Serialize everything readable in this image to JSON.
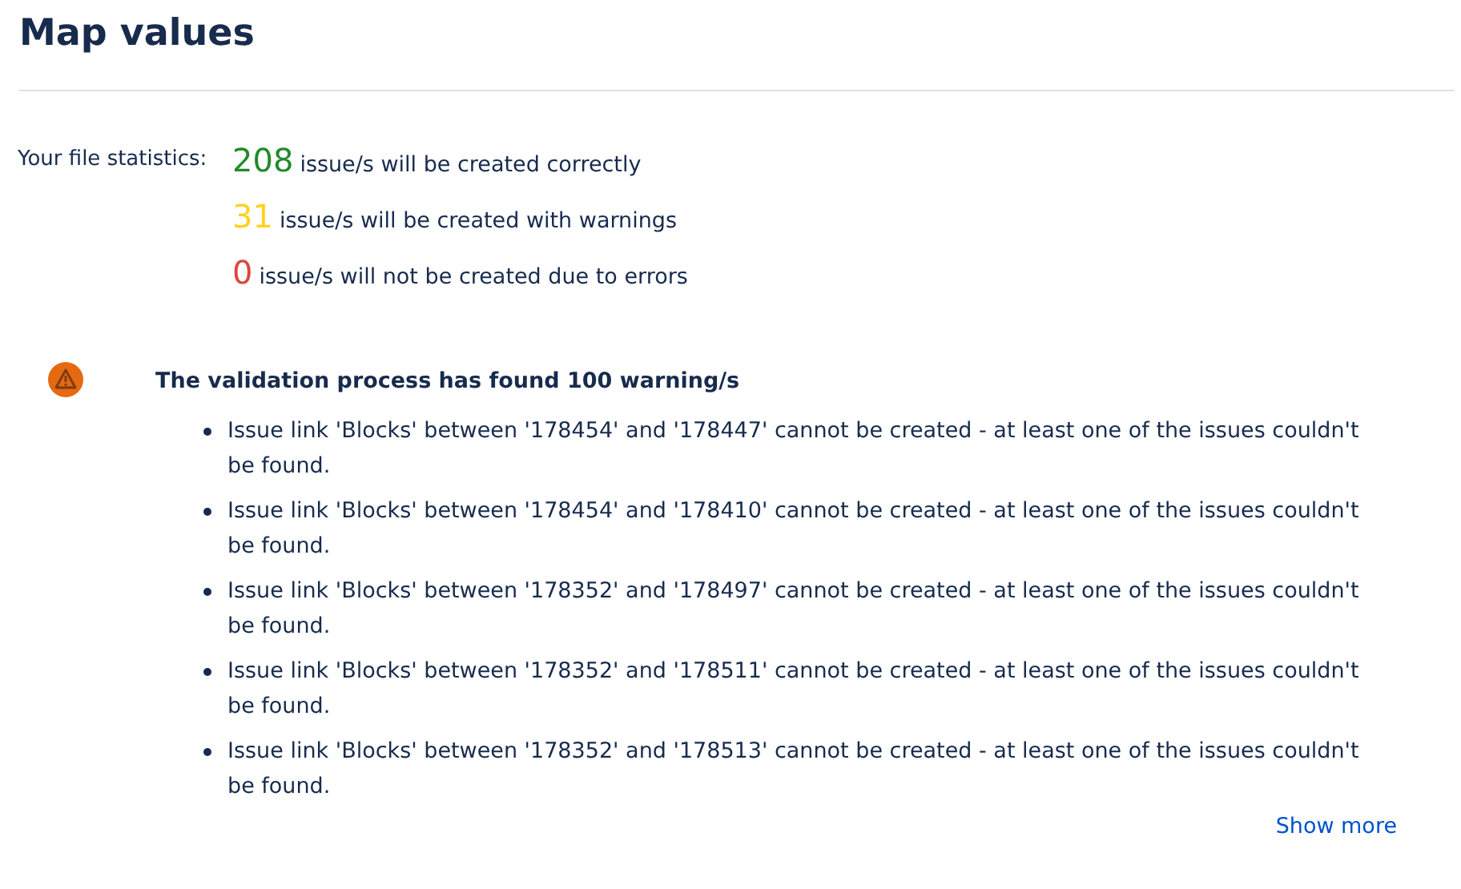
{
  "title": "Map values",
  "statistics": {
    "label": "Your file statistics:",
    "rows": [
      {
        "count": "208",
        "text": "issue/s will be created correctly",
        "color": "#218a2a"
      },
      {
        "count": "31",
        "text": "issue/s will be created with warnings",
        "color": "#ffd21f"
      },
      {
        "count": "0",
        "text": "issue/s will not be created due to errors",
        "color": "#d9493b"
      }
    ]
  },
  "warnings": {
    "heading": "The validation process has found 100 warning/s",
    "items": [
      "Issue link 'Blocks' between '178454' and '178447' cannot be created - at least one of the issues couldn't be found.",
      "Issue link 'Blocks' between '178454' and '178410' cannot be created - at least one of the issues couldn't be found.",
      "Issue link 'Blocks' between '178352' and '178497' cannot be created - at least one of the issues couldn't be found.",
      "Issue link 'Blocks' between '178352' and '178511' cannot be created - at least one of the issues couldn't be found.",
      "Issue link 'Blocks' between '178352' and '178513' cannot be created - at least one of the issues couldn't be found."
    ],
    "show_more": "Show more"
  }
}
